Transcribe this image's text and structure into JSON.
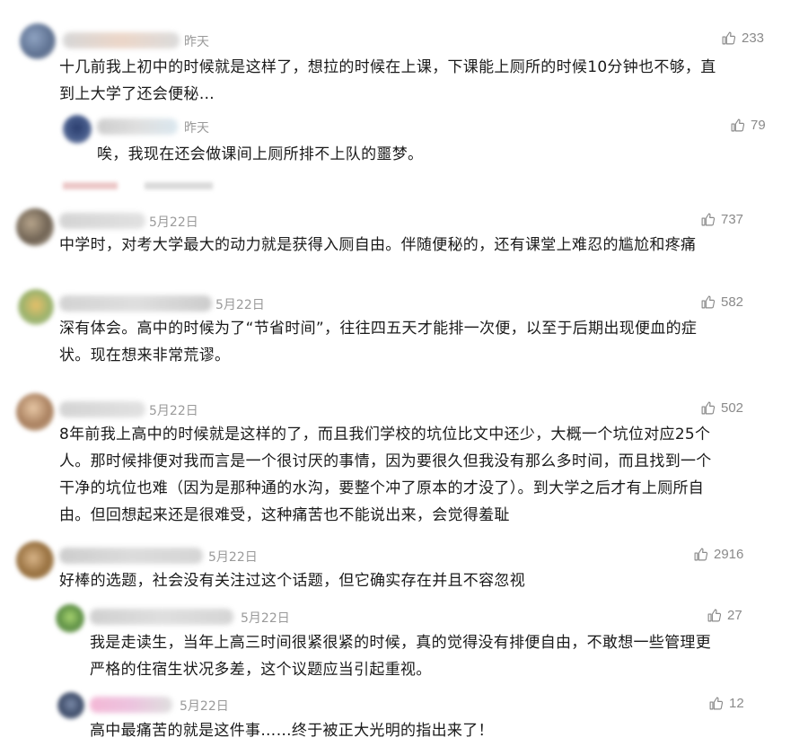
{
  "comments": [
    {
      "date": "昨天",
      "likes": "233",
      "text_lines": [
        "十几前我上初中的时候就是这样了，想拉的时候在上课，下课能上厕所的时候10分钟也不够，直",
        "到上大学了还会便秘…"
      ],
      "reply": {
        "date": "昨天",
        "likes": "79",
        "text_lines": [
          "唉，我现在还会做课间上厕所排不上队的噩梦。"
        ]
      }
    },
    {
      "date": "5月22日",
      "likes": "737",
      "text_lines": [
        "中学时，对考大学最大的动力就是获得入厕自由。伴随便秘的，还有课堂上难忍的尴尬和疼痛"
      ]
    },
    {
      "date": "5月22日",
      "likes": "582",
      "text_lines": [
        "深有体会。高中的时候为了“节省时间”，往往四五天才能排一次便，以至于后期出现便血的症",
        "状。现在想来非常荒谬。"
      ]
    },
    {
      "date": "5月22日",
      "likes": "502",
      "text_lines": [
        "8年前我上高中的时候就是这样的了，而且我们学校的坑位比文中还少，大概一个坑位对应25个",
        "人。那时候排便对我而言是一个很讨厌的事情，因为要很久但我没有那么多时间，而且找到一个",
        "干净的坑位也难（因为是那种通的水沟，要整个冲了原本的才没了）。到大学之后才有上厕所自",
        "由。但回想起来还是很难受，这种痛苦也不能说出来，会觉得羞耻"
      ]
    },
    {
      "date": "5月22日",
      "likes": "2916",
      "text_lines": [
        "好棒的选题，社会没有关注过这个话题，但它确实存在并且不容忽视"
      ],
      "replies": [
        {
          "date": "5月22日",
          "likes": "27",
          "text_lines": [
            "我是走读生，当年上高三时间很紧很紧的时候，真的觉得没有排便自由，不敢想一些管理更",
            "严格的住宿生状况多差，这个议题应当引起重视。"
          ]
        },
        {
          "date": "5月22日",
          "likes": "12",
          "text_lines": [
            "高中最痛苦的就是这件事……终于被正大光明的指出来了！"
          ]
        }
      ]
    }
  ],
  "icons": {
    "like": "thumbs-up-icon"
  }
}
